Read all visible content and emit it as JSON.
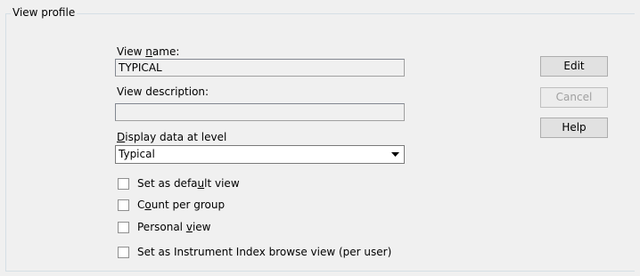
{
  "group": {
    "title": "View profile"
  },
  "form": {
    "view_name_label_pre": "View ",
    "view_name_label_ul": "n",
    "view_name_label_post": "ame:",
    "view_name_value": "TYPICAL",
    "view_description_label": "View description:",
    "view_description_value": "",
    "display_level_label_ul": "D",
    "display_level_label_post": "isplay data at level",
    "display_level_selected": "Typical"
  },
  "checkboxes": {
    "default_view_pre": "Set as defa",
    "default_view_ul": "u",
    "default_view_post": "lt view",
    "default_view_checked": false,
    "count_per_group_pre": "C",
    "count_per_group_ul": "o",
    "count_per_group_post": "unt per group",
    "count_per_group_checked": false,
    "personal_view_pre": "Personal ",
    "personal_view_ul": "v",
    "personal_view_post": "iew",
    "personal_view_checked": false,
    "instrument_index_label": "Set as Instrument Index browse view (per user)",
    "instrument_index_checked": false
  },
  "buttons": {
    "edit_label": "Edit",
    "cancel_label": "Cancel",
    "cancel_enabled": false,
    "help_label": "Help"
  },
  "icons": {
    "dropdown": "chevron-down-icon"
  },
  "colors": {
    "background": "#f0f0f0",
    "disabled_text": "#a0a0a0"
  }
}
